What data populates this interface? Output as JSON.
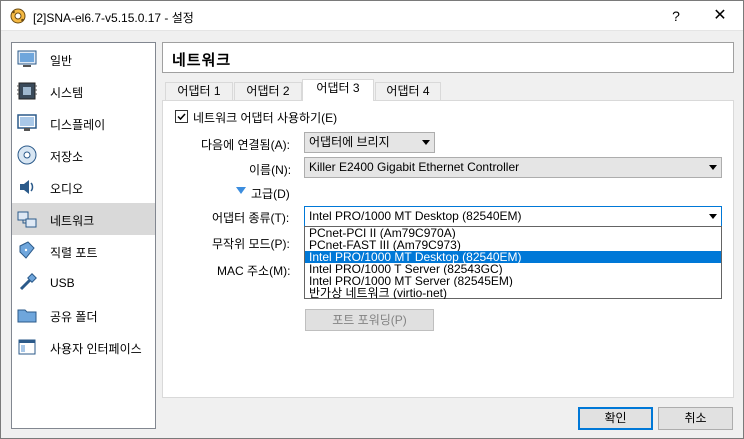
{
  "window": {
    "title": "[2]SNA-el6.7-v5.15.0.17 - 설정",
    "help_glyph": "?",
    "close_glyph": "✕"
  },
  "sidebar": {
    "items": [
      {
        "label": "일반",
        "icon": "general-icon"
      },
      {
        "label": "시스템",
        "icon": "system-icon"
      },
      {
        "label": "디스플레이",
        "icon": "display-icon"
      },
      {
        "label": "저장소",
        "icon": "storage-icon"
      },
      {
        "label": "오디오",
        "icon": "audio-icon"
      },
      {
        "label": "네트워크",
        "icon": "network-icon",
        "selected": true
      },
      {
        "label": "직렬 포트",
        "icon": "serial-port-icon"
      },
      {
        "label": "USB",
        "icon": "usb-icon"
      },
      {
        "label": "공유 폴더",
        "icon": "shared-folder-icon"
      },
      {
        "label": "사용자 인터페이스",
        "icon": "user-interface-icon"
      }
    ]
  },
  "page": {
    "title": "네트워크"
  },
  "tabs": [
    {
      "label": "어댑터 1"
    },
    {
      "label": "어댑터 2"
    },
    {
      "label": "어댑터 3",
      "active": true
    },
    {
      "label": "어댑터 4"
    }
  ],
  "adapter": {
    "enable_label": "네트워크 어댑터 사용하기(E)",
    "enable_checked": true,
    "attached_label": "다음에 연결됨(A):",
    "attached_value": "어댑터에 브리지",
    "name_label": "이름(N):",
    "name_value": "Killer E2400 Gigabit Ethernet Controller",
    "advanced_label": "고급(D)",
    "type_label": "어댑터 종류(T):",
    "type_value": "Intel PRO/1000 MT Desktop (82540EM)",
    "promisc_label": "무작위 모드(P):",
    "mac_label": "MAC 주소(M):",
    "port_forwarding_label": "포트 포워딩(P)"
  },
  "type_options": [
    "PCnet-PCI II (Am79C970A)",
    "PCnet-FAST III (Am79C973)",
    "Intel PRO/1000 MT Desktop (82540EM)",
    "Intel PRO/1000 T Server (82543GC)",
    "Intel PRO/1000 MT Server (82545EM)",
    "반가상 네트워크 (virtio-net)"
  ],
  "type_selected_index": 2,
  "buttons": {
    "ok": "확인",
    "cancel": "취소"
  },
  "colors": {
    "selection": "#0078d7",
    "accent": "#3c8dde"
  }
}
